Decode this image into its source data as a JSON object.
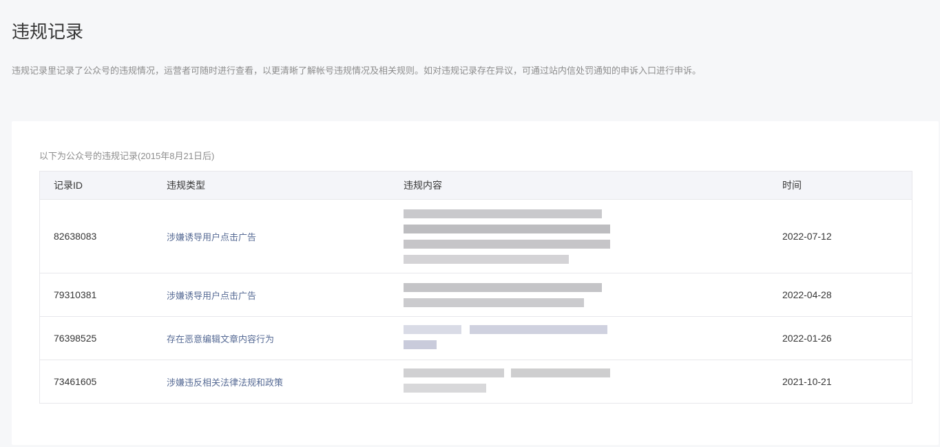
{
  "header": {
    "title": "违规记录",
    "description": "违规记录里记录了公众号的违规情况，运营者可随时进行查看，以更清晰了解帐号违规情况及相关规则。如对违规记录存在异议，可通过站内信处罚通知的申诉入口进行申诉。"
  },
  "records": {
    "caption": "以下为公众号的违规记录(2015年8月21日后)",
    "columns": [
      "记录ID",
      "违规类型",
      "违规内容",
      "时间"
    ],
    "rows": [
      {
        "id": "82638083",
        "type": "涉嫌诱导用户点击广告",
        "content": "",
        "time": "2022-07-12"
      },
      {
        "id": "79310381",
        "type": "涉嫌诱导用户点击广告",
        "content": "",
        "time": "2022-04-28"
      },
      {
        "id": "76398525",
        "type": "存在恶意编辑文章内容行为",
        "content": "",
        "time": "2022-01-26"
      },
      {
        "id": "73461605",
        "type": "涉嫌违反相关法律法规和政策",
        "content": "",
        "time": "2021-10-21"
      }
    ]
  },
  "colors": {
    "background": "#f6f7f9",
    "card": "#ffffff",
    "header_row": "#f4f5f9",
    "link": "#576b95",
    "muted_text": "#8d8d8d",
    "border": "#e7e7eb"
  }
}
